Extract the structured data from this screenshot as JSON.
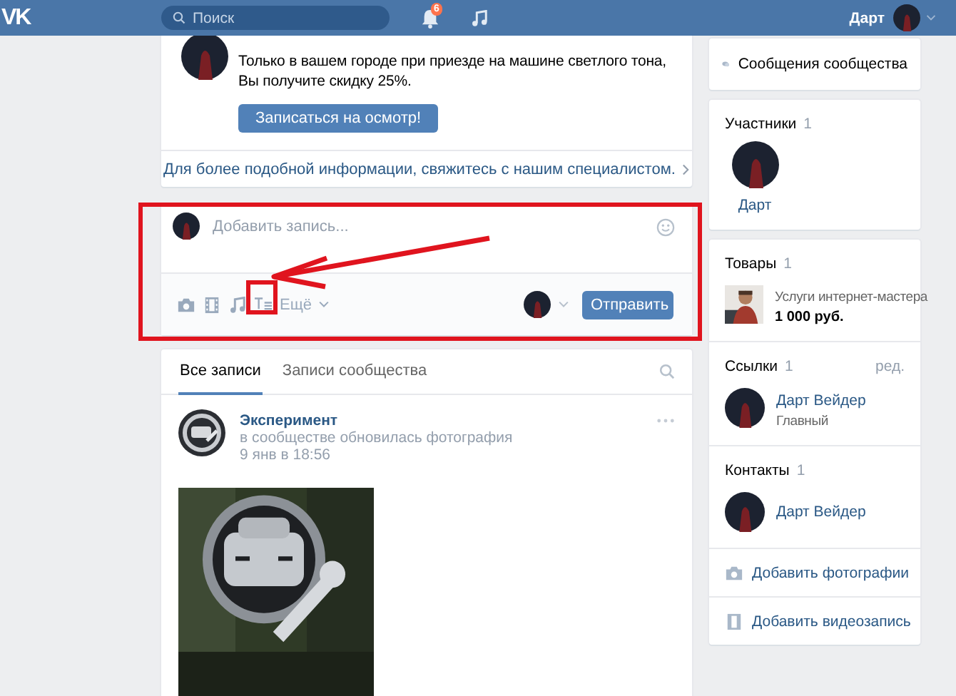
{
  "header": {
    "logo": "VK",
    "search": {
      "placeholder": "Поиск"
    },
    "notification_count": "6",
    "user_name": "Дарт"
  },
  "promo_card": {
    "text": "Только в вашем городе при приезде на машине светлого тона, Вы получите скидку 25%.",
    "button": "Записаться на осмотр!",
    "more_link": "Для более подобной информации, свяжитесь с нашим специалистом."
  },
  "composer": {
    "placeholder": "Добавить запись...",
    "more": "Ещё",
    "submit": "Отправить"
  },
  "wall": {
    "tabs": [
      {
        "label": "Все записи",
        "selected": true
      },
      {
        "label": "Записи сообщества",
        "selected": false
      }
    ],
    "post": {
      "author": "Эксперимент",
      "action": "в сообществе обновилась фотография",
      "date": "9 янв в 18:56"
    }
  },
  "sidebar": {
    "messages": "Сообщения сообщества",
    "members": {
      "title": "Участники",
      "count": "1",
      "items": [
        {
          "name": "Дарт"
        }
      ]
    },
    "goods": {
      "title": "Товары",
      "count": "1",
      "items": [
        {
          "name": "Услуги интернет-мастера",
          "price": "1 000 руб."
        }
      ]
    },
    "links": {
      "title": "Ссылки",
      "count": "1",
      "edit": "ред.",
      "items": [
        {
          "name": "Дарт Вейдер",
          "description": "Главный"
        }
      ]
    },
    "contacts": {
      "title": "Контакты",
      "count": "1",
      "items": [
        {
          "name": "Дарт Вейдер"
        }
      ]
    },
    "actions": [
      {
        "label": "Добавить фотографии"
      },
      {
        "kind": "video",
        "label": "Добавить видеозапись"
      }
    ]
  }
}
